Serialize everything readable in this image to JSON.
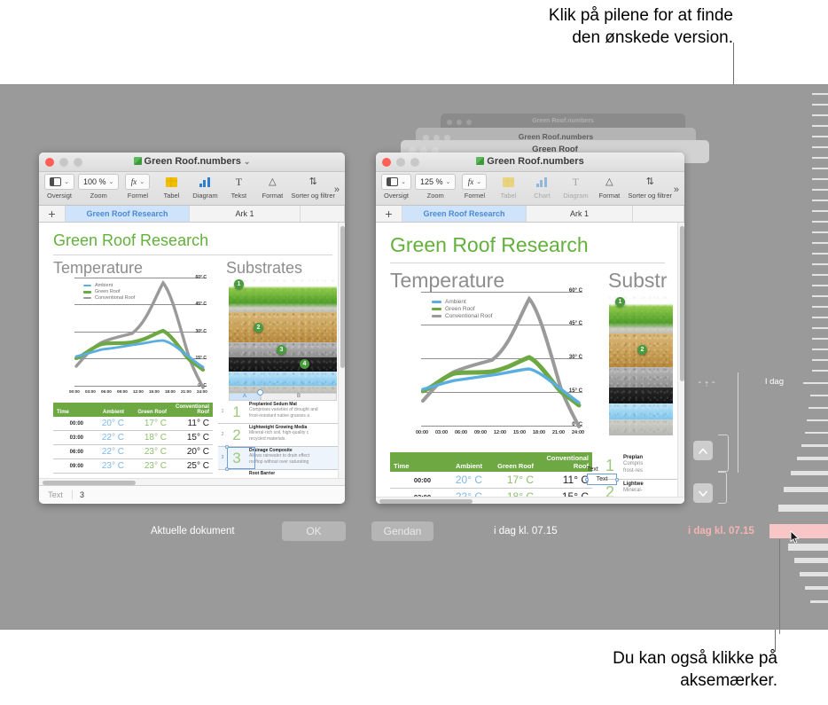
{
  "captions": {
    "top": "Klik på pilene for at finde\nden ønskede version.",
    "bottom": "Du kan også klikke på\naksemærker."
  },
  "left_window": {
    "title": "Green Roof.numbers",
    "title_chevron": "⌄",
    "toolbar": [
      {
        "label": "Oversigt",
        "icon": "sidebar-icon",
        "caret": "⌄",
        "dim": false
      },
      {
        "label": "Zoom",
        "icon": "zoom-percent",
        "value": "100 %",
        "caret": "⌄",
        "dim": false
      },
      {
        "label": "Formel",
        "icon": "fx-icon",
        "value": "fx",
        "caret": "⌄",
        "dim": false
      },
      {
        "label": "Tabel",
        "icon": "table-icon",
        "dim": false
      },
      {
        "label": "Diagram",
        "icon": "chart-icon",
        "dim": false
      },
      {
        "label": "Tekst",
        "icon": "text-icon",
        "value": "T",
        "dim": false
      },
      {
        "label": "Format",
        "icon": "format-brush-icon",
        "value": "✄",
        "dim": false
      },
      {
        "label": "Sorter og filtrer",
        "icon": "sort-filter-icon",
        "value": "⇅",
        "dim": false
      }
    ],
    "toolbar_overflow": "»",
    "sheets": {
      "add": "+",
      "tabs": [
        "Green Roof Research",
        "Ark 1"
      ],
      "active": 0
    },
    "formula_bar": {
      "label": "Text",
      "value": "3"
    }
  },
  "right_window": {
    "title": "Green Roof.numbers",
    "toolbar": [
      {
        "label": "Oversigt",
        "icon": "sidebar-icon",
        "caret": "⌄",
        "dim": false
      },
      {
        "label": "Zoom",
        "icon": "zoom-percent",
        "value": "125 %",
        "caret": "⌄",
        "dim": false
      },
      {
        "label": "Formel",
        "icon": "fx-icon",
        "value": "fx",
        "caret": "⌄",
        "dim": false
      },
      {
        "label": "Tabel",
        "icon": "table-icon",
        "dim": true
      },
      {
        "label": "Chart",
        "icon": "chart-icon",
        "dim": true
      },
      {
        "label": "Diagram",
        "icon": "text-icon",
        "value": "T",
        "dim": true
      },
      {
        "label": "Format",
        "icon": "format-brush-icon",
        "value": "✄",
        "dim": false
      },
      {
        "label": "Sorter og filtrer",
        "icon": "sort-filter-icon",
        "value": "⇅",
        "dim": false
      }
    ],
    "toolbar_overflow": "»",
    "sheets": {
      "add": "+",
      "tabs": [
        "Green Roof Research",
        "Ark 1"
      ],
      "active": 0
    },
    "selection_tooltip": {
      "label": "Text",
      "inner": "Text"
    }
  },
  "stacked_windows": [
    {
      "title": "Green Roof.numbers"
    },
    {
      "title": "Green Roof.numbers"
    },
    {
      "title": "Green Roof"
    }
  ],
  "document": {
    "title": "Green Roof Research",
    "sections": {
      "temperature": "Temperature",
      "substrates": "Substrates",
      "substrates_clipped": "Substr"
    }
  },
  "chart_data": {
    "type": "line",
    "title": "Temperature",
    "xlabel": "",
    "ylabel": "",
    "ylim": [
      0,
      60
    ],
    "yticks": [
      "0° C",
      "15° C",
      "30° C",
      "45° C",
      "60° C"
    ],
    "x": [
      "00:00",
      "03:00",
      "06:00",
      "09:00",
      "12:00",
      "15:00",
      "18:00",
      "21:00",
      "24:00"
    ],
    "grid": true,
    "legend_position": "top-left",
    "series": [
      {
        "name": "Ambient",
        "color": "#5aaee0",
        "values": [
          19,
          20,
          22,
          23,
          24,
          25,
          25,
          22,
          19
        ]
      },
      {
        "name": "Green Roof",
        "color": "#6da843",
        "values": [
          16,
          18,
          23,
          23,
          23,
          26,
          29,
          24,
          18
        ]
      },
      {
        "name": "Conventional Roof",
        "color": "#9a9a9a",
        "values": [
          9,
          14,
          20,
          25,
          39,
          52,
          60,
          52,
          10
        ]
      }
    ]
  },
  "data_table": {
    "headers": [
      "Time",
      "Ambient",
      "Green Roof",
      "Conventional Roof"
    ],
    "rows": [
      [
        "00:00",
        "20° C",
        "17° C",
        "11° C"
      ],
      [
        "03:00",
        "22° C",
        "18° C",
        "15° C"
      ],
      [
        "06:00",
        "22° C",
        "23° C",
        "20° C"
      ],
      [
        "09:00",
        "23° C",
        "23° C",
        "25° C"
      ]
    ]
  },
  "substrates": {
    "column_headers": [
      "A",
      "B"
    ],
    "row_numbers": [
      "1",
      "2",
      "3"
    ],
    "selected_cell": "3",
    "badges": [
      "1",
      "2",
      "3",
      "4"
    ],
    "items": [
      {
        "num": "1",
        "heading": "Preplanted Sedum Mat",
        "desc": "Comprises varieties of drought and\nfrost-resistant native grasses a"
      },
      {
        "num": "2",
        "heading": "Lightweight Growing Media",
        "desc": "Mineral-rich soil, high-quality c\nrecycled materials."
      },
      {
        "num": "3",
        "heading": "Drainage Composite",
        "desc": "Allows rainwater to drain effect\nrooftop without over saturating"
      },
      {
        "num": "4",
        "heading": "Root Barrier",
        "desc": ""
      }
    ],
    "items_clipped": [
      {
        "num": "1",
        "heading": "Preplan",
        "desc": "Compris\nfrost-res"
      },
      {
        "num": "2",
        "heading": "Lightwe",
        "desc": "Mineral-"
      }
    ]
  },
  "bottom_bar": {
    "current_doc_label": "Aktuelle dokument",
    "ok_label": "OK",
    "restore_label": "Gendan",
    "date_left": "i dag kl. 07.15",
    "date_right": "i dag kl. 07.15"
  },
  "navigator": {
    "up_arrow": "⌃",
    "down_arrow": "⌄",
    "glyph": "⌃⇡⌃"
  },
  "ruler": {
    "today_label": "I dag"
  },
  "colors": {
    "desktop": "#9a9a9a",
    "accent_green": "#63b03c",
    "header_green": "#6da843",
    "ambient_blue": "#5aaee0",
    "conventional_grey": "#9a9a9a",
    "selection_pink": "#f8c6c6",
    "tab_blue": "#cfe3fb"
  }
}
